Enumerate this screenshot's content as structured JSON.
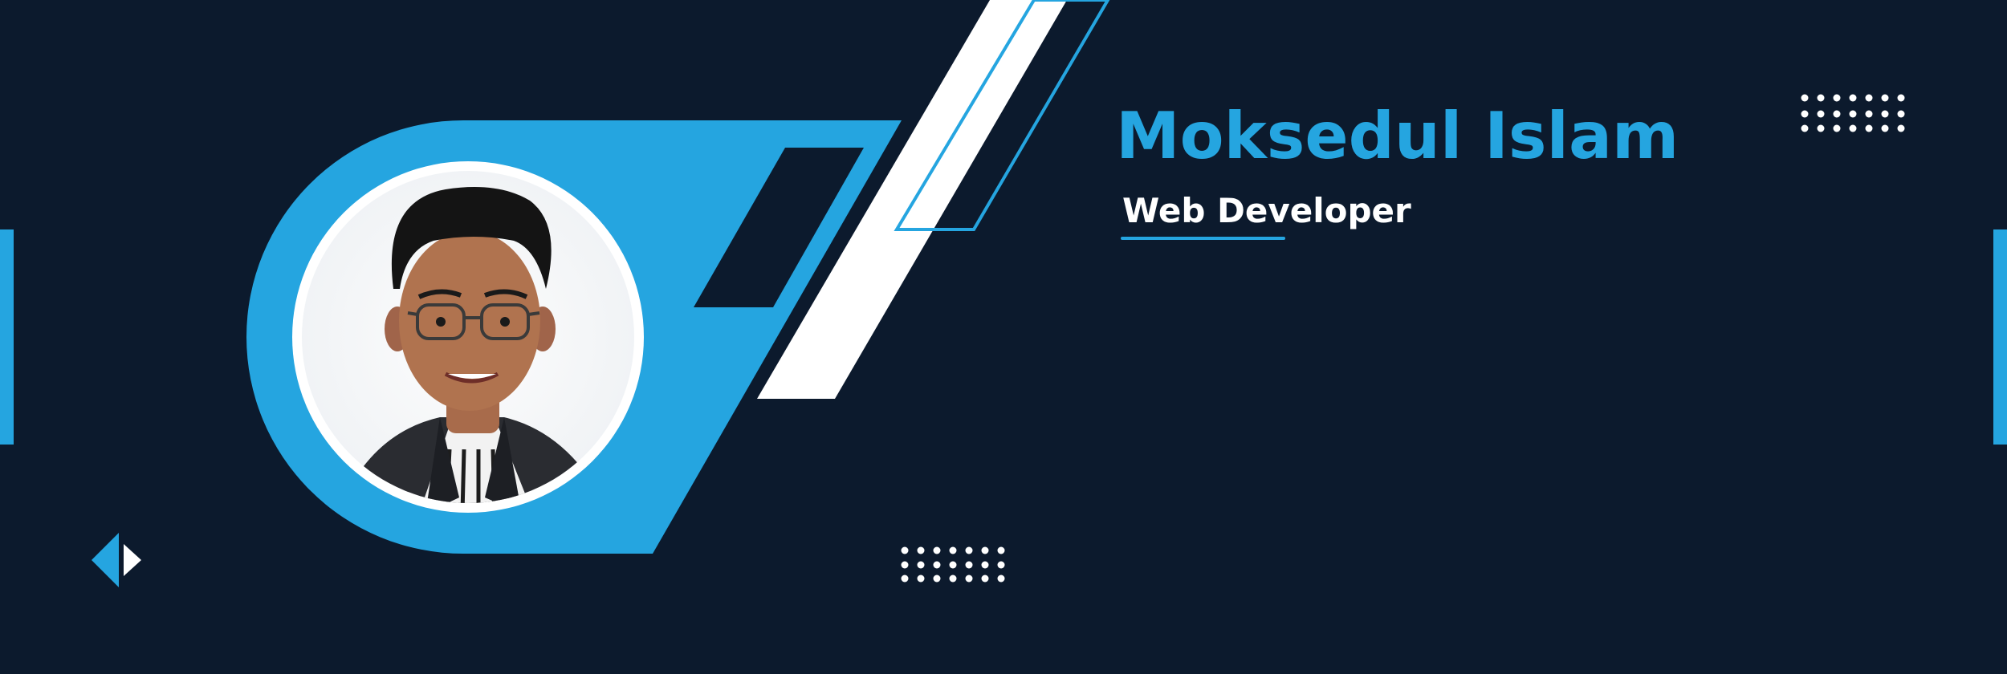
{
  "profile": {
    "name": "Moksedul Islam",
    "role": "Web Developer"
  },
  "colors": {
    "background": "#0c1a2d",
    "accent": "#25a5e0",
    "text": "#ffffff"
  },
  "icons": {
    "photo": "avatar-portrait",
    "decor_arrow": "diamond-arrow-icon",
    "dots": "dot-grid-icon"
  }
}
